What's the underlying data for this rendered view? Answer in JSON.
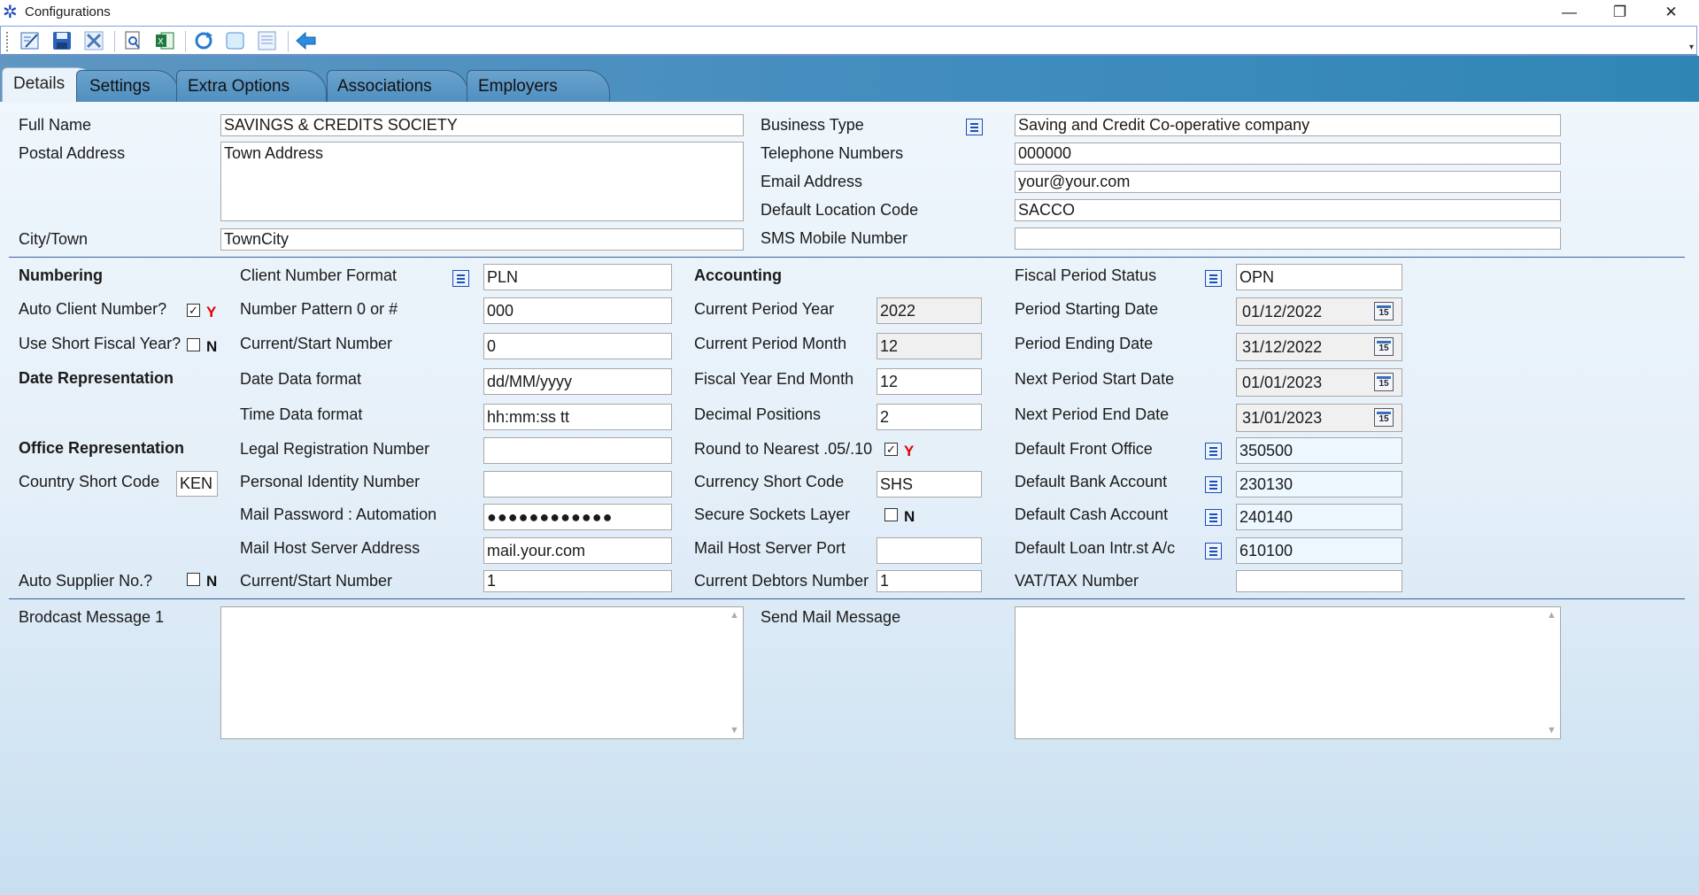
{
  "window": {
    "title": "Configurations",
    "controls": {
      "minimize": "—",
      "restore": "❐",
      "close": "✕"
    }
  },
  "toolbar": {
    "icons": [
      "edit-icon",
      "save-icon",
      "cancel-icon",
      "preview-icon",
      "excel-icon",
      "refresh-icon",
      "blank-icon",
      "list-icon",
      "back-arrow-icon"
    ],
    "overflow": "▾"
  },
  "tabs": [
    "Details",
    "Settings",
    "Extra Options",
    "Associations",
    "Employers"
  ],
  "top": {
    "full_name": {
      "label": "Full Name",
      "value": "SAVINGS & CREDITS SOCIETY"
    },
    "postal_address": {
      "label": "Postal Address",
      "value": "Town Address"
    },
    "city": {
      "label": "City/Town",
      "value": "TownCity"
    },
    "business_type": {
      "label": "Business Type",
      "value": "Saving and Credit Co-operative company"
    },
    "telephone": {
      "label": "Telephone Numbers",
      "value": "000000"
    },
    "email": {
      "label": "Email Address",
      "value": "your@your.com"
    },
    "location": {
      "label": "Default Location Code",
      "value": "SACCO"
    },
    "sms": {
      "label": "SMS Mobile Number",
      "value": ""
    }
  },
  "left": {
    "numbering": "Numbering",
    "auto_client": {
      "label": "Auto Client Number?",
      "flag": "Y",
      "check": "✓"
    },
    "short_fiscal": {
      "label": "Use Short Fiscal Year?",
      "flag": "N"
    },
    "date_repr": "Date Representation",
    "office_repr": "Office Representation",
    "country": {
      "label": "Country Short Code",
      "value": "KEN"
    },
    "auto_supplier": {
      "label": "Auto Supplier No.?",
      "flag": "N"
    }
  },
  "mid": {
    "client_format": {
      "label": "Client Number Format",
      "value": "PLN"
    },
    "number_pattern": {
      "label": "Number Pattern 0 or #",
      "value": "000"
    },
    "current_start": {
      "label": "Current/Start Number",
      "value": "0"
    },
    "date_format": {
      "label": "Date Data format",
      "value": "dd/MM/yyyy"
    },
    "time_format": {
      "label": "Time Data format",
      "value": "hh:mm:ss tt"
    },
    "legal_reg": {
      "label": "Legal Registration Number",
      "value": ""
    },
    "personal_id": {
      "label": "Personal Identity Number",
      "value": ""
    },
    "mail_password": {
      "label": "Mail Password : Automation",
      "value": "●●●●●●●●●●●●"
    },
    "mail_host": {
      "label": "Mail Host Server Address",
      "value": "mail.your.com"
    },
    "current_start2": {
      "label": "Current/Start Number",
      "value": "1"
    }
  },
  "acct": {
    "heading": "Accounting",
    "period_year": {
      "label": "Current Period Year",
      "value": "2022"
    },
    "period_month": {
      "label": "Current Period Month",
      "value": "12"
    },
    "fy_end_month": {
      "label": "Fiscal Year End Month",
      "value": "12"
    },
    "decimals": {
      "label": "Decimal Positions",
      "value": "2"
    },
    "round": {
      "label": "Round to Nearest .05/.10",
      "flag": "Y",
      "check": "✓"
    },
    "currency": {
      "label": "Currency Short Code",
      "value": "SHS"
    },
    "ssl": {
      "label": "Secure Sockets Layer",
      "flag": "N"
    },
    "mail_port": {
      "label": "Mail Host Server Port",
      "value": ""
    },
    "debtors": {
      "label": "Current Debtors Number",
      "value": "1"
    }
  },
  "period": {
    "status": {
      "label": "Fiscal Period Status",
      "value": "OPN"
    },
    "start": {
      "label": "Period Starting Date",
      "value": "01/12/2022"
    },
    "end": {
      "label": "Period Ending Date",
      "value": "31/12/2022"
    },
    "next_start": {
      "label": "Next Period Start Date",
      "value": "01/01/2023"
    },
    "next_end": {
      "label": "Next Period End Date",
      "value": "31/01/2023"
    },
    "front_office": {
      "label": "Default Front Office",
      "value": "350500"
    },
    "bank": {
      "label": "Default Bank Account",
      "value": "230130"
    },
    "cash": {
      "label": "Default Cash Account",
      "value": "240140"
    },
    "loan": {
      "label": "Default Loan Intr.st A/c",
      "value": "610100"
    },
    "vat": {
      "label": "VAT/TAX Number",
      "value": ""
    },
    "cal_day": "15"
  },
  "bottom": {
    "broadcast": {
      "label": "Brodcast Message 1",
      "value": ""
    },
    "send_mail": {
      "label": "Send Mail Message",
      "value": ""
    },
    "scroll_up": "▲",
    "scroll_down": "▼"
  }
}
